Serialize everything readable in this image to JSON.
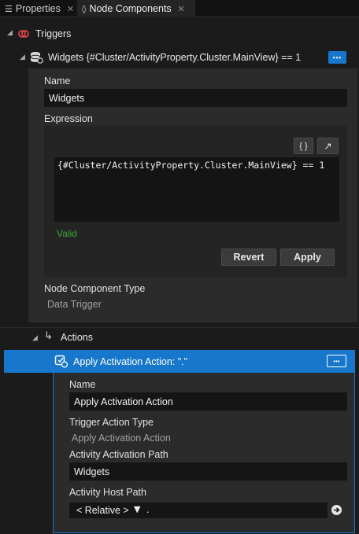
{
  "tabs": [
    {
      "label": "Properties",
      "icon": "list-icon"
    },
    {
      "label": "Node Components",
      "icon": "node-components-icon"
    }
  ],
  "triggers": {
    "label": "Triggers",
    "trigger": {
      "title": "Widgets {#Cluster/ActivityProperty.Cluster.MainView} == 1",
      "name_label": "Name",
      "name_value": "Widgets",
      "expression_label": "Expression",
      "expression_value": "{#Cluster/ActivityProperty.Cluster.MainView} == 1",
      "braces_label": "{ }",
      "expand_glyph": "↗",
      "valid_text": "Valid",
      "revert_label": "Revert",
      "apply_label": "Apply",
      "type_label": "Node Component Type",
      "type_value": "Data Trigger",
      "more_label": "•••"
    }
  },
  "actions": {
    "label": "Actions",
    "action": {
      "title": "Apply Activation Action: \".\"",
      "name_label": "Name",
      "name_value": "Apply Activation Action",
      "trigger_type_label": "Trigger Action Type",
      "trigger_type_value": "Apply Activation Action",
      "activation_path_label": "Activity Activation Path",
      "activation_path_value": "Widgets",
      "host_path_label": "Activity Host Path",
      "host_path_select": "< Relative >",
      "host_path_value": ".",
      "more_label": "•••"
    }
  },
  "colors": {
    "accent": "#1677cc",
    "valid": "#3aa53a",
    "trigger_icon": "#e0444b"
  }
}
